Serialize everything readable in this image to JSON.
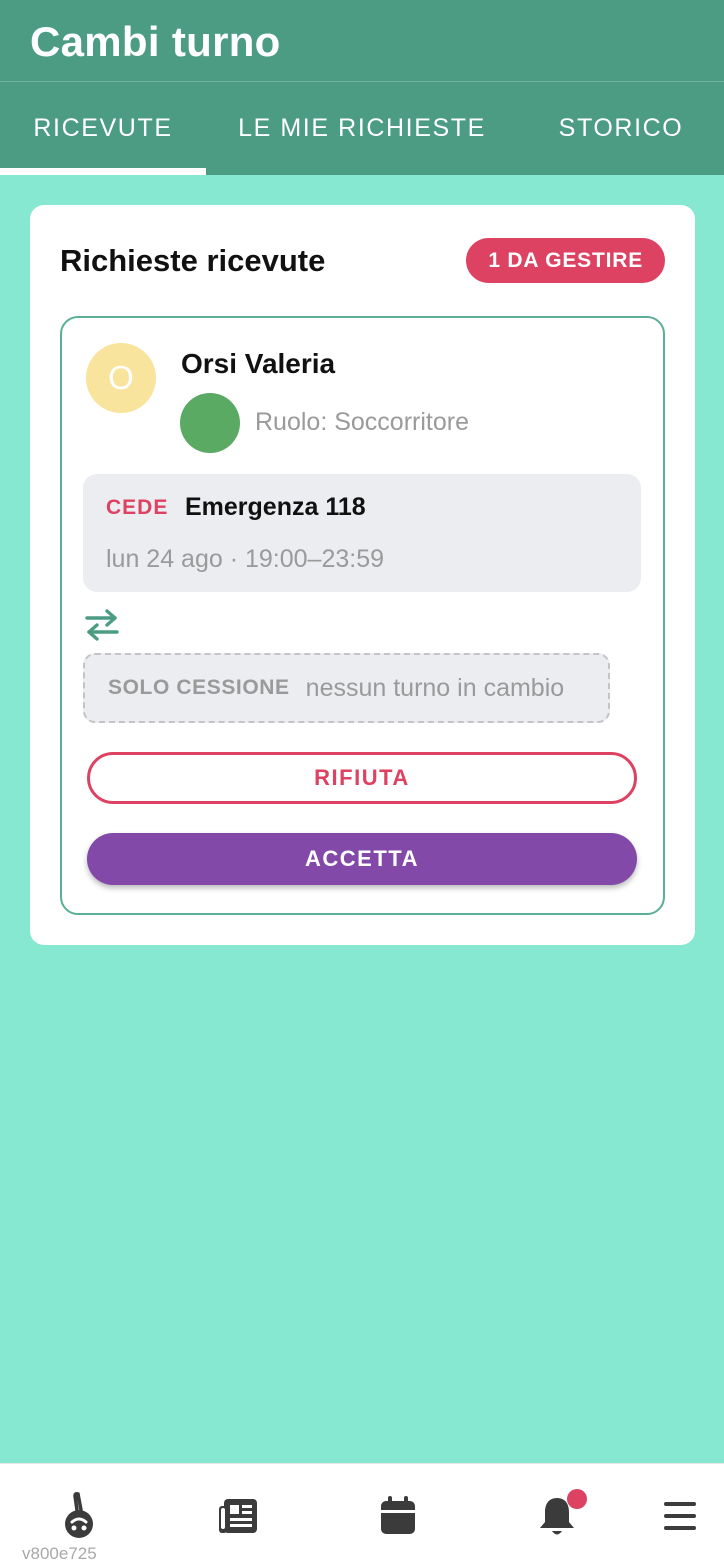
{
  "header": {
    "title": "Cambi turno"
  },
  "tabs": [
    {
      "label": "RICEVUTE",
      "active": true
    },
    {
      "label": "LE MIE RICHIESTE",
      "active": false
    },
    {
      "label": "STORICO",
      "active": false
    }
  ],
  "received": {
    "title": "Richieste ricevute",
    "badge": "1 DA GESTIRE",
    "request": {
      "avatar_initial": "O",
      "name": "Orsi Valeria",
      "role": "Ruolo: Soccorritore",
      "shift_tag": "CEDE",
      "shift_name": "Emergenza 118",
      "shift_time": "lun 24 ago · 19:00–23:59",
      "cession_tag": "SOLO CESSIONE",
      "cession_text": "nessun turno in cambio",
      "reject_label": "RIFIUTA",
      "accept_label": "ACCETTA"
    }
  },
  "bottom_nav": {
    "items": [
      "home-icon",
      "news-icon",
      "calendar-icon",
      "bell-icon",
      "menu-icon"
    ],
    "version": "v800e725"
  },
  "colors": {
    "header": "#4C9C84",
    "background": "#86E8D0",
    "accent_red": "#DE4262",
    "accent_purple": "#8349A9",
    "card_border": "#5BAF96"
  }
}
